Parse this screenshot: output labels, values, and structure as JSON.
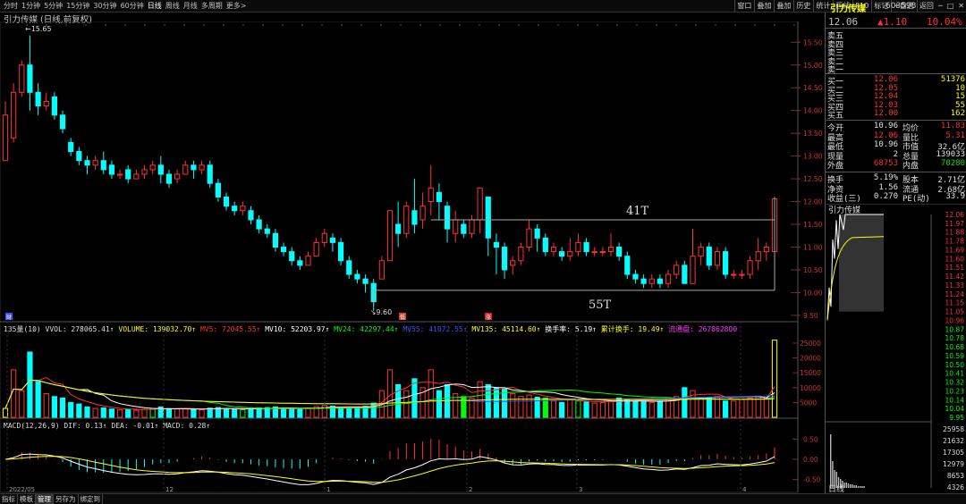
{
  "toolbar": {
    "periods": [
      "分时",
      "1分钟",
      "5分钟",
      "15分钟",
      "30分钟",
      "60分钟",
      "日线",
      "周线",
      "月线",
      "多周期",
      "更多>"
    ],
    "active_period": "日线",
    "tools": [
      "叠加",
      "叠加",
      "历史",
      "统计",
      "画线",
      "F10",
      "标记",
      "+自选",
      "返回"
    ],
    "tools_first": "窗口"
  },
  "chart": {
    "title": "引力传媒 (日线,前复权)",
    "high_label": "15.65",
    "low_label": "9.60",
    "annotation_41": "41T",
    "annotation_55": "55T",
    "marker_left": "财",
    "marker_mid1": "低",
    "marker_mid2": "涨",
    "y_ticks": [
      "15.50",
      "15.00",
      "14.50",
      "14.00",
      "13.50",
      "13.00",
      "12.50",
      "12.00",
      "11.50",
      "11.00",
      "10.50",
      "10.00",
      "9.50"
    ],
    "vol_ticks": [
      "25000",
      "20000",
      "15000",
      "10000",
      "5000"
    ],
    "macd_ticks": [
      "0.50",
      "0.00",
      "-0.50"
    ],
    "x_labels": [
      "2022/05",
      "12",
      "1",
      "2",
      "3",
      "4"
    ]
  },
  "chart_data": {
    "type": "candlestick",
    "ylim": [
      9.4,
      15.8
    ],
    "candles": [
      [
        12.9,
        13.9,
        13.3,
        14.1,
        14.2
      ],
      [
        13.4,
        14.4,
        13.3,
        14.6,
        14.6
      ],
      [
        14.4,
        15.0,
        14.3,
        15.1,
        15.1
      ],
      [
        15.0,
        14.4,
        14.0,
        15.65,
        15.65
      ],
      [
        14.4,
        14.1,
        13.9,
        14.6,
        14.6
      ],
      [
        14.1,
        14.2,
        14.0,
        14.4,
        14.4
      ],
      [
        14.3,
        13.9,
        13.8,
        14.4,
        14.4
      ],
      [
        13.9,
        13.6,
        13.5,
        14.0,
        14.0
      ],
      [
        13.3,
        13.1,
        13.0,
        13.4,
        13.4
      ],
      [
        13.1,
        12.9,
        12.8,
        13.2,
        13.2
      ],
      [
        12.9,
        12.8,
        12.6,
        13.0,
        13.0
      ],
      [
        12.8,
        12.9,
        12.7,
        13.0,
        13.0
      ],
      [
        12.9,
        12.7,
        12.6,
        13.1,
        13.1
      ],
      [
        12.8,
        12.6,
        12.5,
        12.9,
        12.9
      ],
      [
        12.6,
        12.6,
        12.5,
        12.7,
        12.7
      ],
      [
        12.7,
        12.5,
        12.4,
        12.8,
        12.8
      ],
      [
        12.5,
        12.6,
        12.5,
        12.7,
        12.7
      ],
      [
        12.6,
        12.7,
        12.5,
        12.8,
        12.8
      ],
      [
        12.7,
        12.8,
        12.6,
        12.9,
        12.9
      ],
      [
        12.8,
        12.6,
        12.4,
        13.0,
        13.0
      ],
      [
        12.6,
        12.4,
        12.3,
        12.7,
        12.7
      ],
      [
        12.5,
        12.6,
        12.4,
        12.7,
        12.7
      ],
      [
        12.6,
        12.8,
        12.6,
        12.9,
        12.9
      ],
      [
        12.8,
        12.7,
        12.5,
        12.9,
        12.9
      ],
      [
        12.7,
        12.8,
        12.6,
        12.9,
        12.9
      ],
      [
        12.8,
        12.4,
        12.3,
        12.9,
        12.9
      ],
      [
        12.4,
        12.1,
        12.0,
        12.5,
        12.5
      ],
      [
        12.1,
        11.9,
        11.8,
        12.2,
        12.2
      ],
      [
        11.9,
        11.8,
        11.7,
        12.0,
        12.0
      ],
      [
        11.8,
        11.9,
        11.7,
        12.0,
        12.0
      ],
      [
        11.8,
        11.6,
        11.5,
        11.9,
        11.9
      ],
      [
        11.6,
        11.4,
        11.3,
        11.7,
        11.7
      ],
      [
        11.4,
        11.3,
        11.2,
        11.5,
        11.5
      ],
      [
        11.3,
        11.0,
        10.9,
        11.4,
        11.4
      ],
      [
        11.0,
        10.9,
        10.8,
        11.1,
        11.1
      ],
      [
        10.9,
        10.7,
        10.6,
        11.0,
        11.0
      ],
      [
        10.7,
        10.6,
        10.5,
        10.8,
        10.8
      ],
      [
        10.6,
        10.8,
        10.6,
        10.9,
        10.9
      ],
      [
        10.8,
        11.1,
        10.8,
        11.2,
        11.2
      ],
      [
        11.1,
        11.3,
        11.0,
        11.4,
        11.4
      ],
      [
        11.2,
        11.1,
        10.9,
        11.3,
        11.3
      ],
      [
        11.1,
        10.7,
        10.6,
        11.2,
        11.2
      ],
      [
        10.7,
        10.4,
        10.3,
        10.8,
        10.8
      ],
      [
        10.4,
        10.3,
        10.2,
        10.5,
        10.5
      ],
      [
        10.3,
        10.2,
        10.0,
        10.4,
        10.4
      ],
      [
        10.2,
        9.8,
        9.6,
        10.3,
        10.3
      ],
      [
        10.3,
        10.7,
        10.3,
        10.8,
        10.8
      ],
      [
        10.7,
        11.8,
        10.7,
        11.8,
        11.8
      ],
      [
        11.5,
        11.3,
        11.0,
        12.0,
        12.0
      ],
      [
        11.3,
        11.9,
        11.2,
        12.0,
        12.0
      ],
      [
        11.8,
        11.5,
        11.3,
        12.5,
        12.5
      ],
      [
        11.6,
        11.9,
        11.4,
        12.2,
        12.2
      ],
      [
        12.0,
        12.3,
        11.7,
        12.4,
        12.8
      ],
      [
        12.2,
        12.0,
        11.6,
        12.4,
        12.4
      ],
      [
        11.9,
        11.4,
        11.1,
        12.0,
        12.0
      ],
      [
        11.3,
        11.6,
        11.1,
        11.8,
        11.8
      ],
      [
        11.5,
        11.3,
        11.2,
        11.6,
        11.6
      ],
      [
        11.3,
        11.6,
        11.2,
        11.7,
        11.7
      ],
      [
        11.6,
        12.3,
        11.3,
        12.3,
        12.3
      ],
      [
        12.1,
        11.2,
        10.8,
        12.1,
        12.1
      ],
      [
        11.1,
        11.0,
        10.4,
        11.3,
        11.3
      ],
      [
        11.0,
        10.5,
        10.3,
        11.1,
        11.1
      ],
      [
        10.6,
        10.7,
        10.4,
        10.8,
        10.8
      ],
      [
        10.7,
        11.0,
        10.6,
        11.1,
        11.1
      ],
      [
        11.0,
        11.4,
        10.9,
        11.6,
        11.6
      ],
      [
        11.4,
        11.2,
        10.9,
        11.5,
        11.5
      ],
      [
        11.2,
        10.9,
        10.8,
        11.3,
        11.3
      ],
      [
        10.9,
        11.0,
        10.8,
        11.1,
        11.1
      ],
      [
        10.9,
        10.8,
        10.7,
        11.0,
        11.0
      ],
      [
        10.8,
        10.9,
        10.7,
        11.2,
        11.2
      ],
      [
        10.9,
        11.1,
        10.8,
        11.3,
        11.3
      ],
      [
        11.1,
        10.9,
        10.8,
        11.2,
        11.2
      ],
      [
        10.9,
        10.9,
        10.8,
        11.0,
        11.0
      ],
      [
        10.9,
        10.9,
        10.8,
        11.0,
        11.0
      ],
      [
        10.9,
        11.0,
        10.8,
        11.3,
        11.3
      ],
      [
        11.0,
        10.8,
        10.7,
        11.1,
        11.1
      ],
      [
        10.8,
        10.4,
        10.3,
        10.9,
        10.9
      ],
      [
        10.4,
        10.3,
        10.2,
        10.5,
        10.5
      ],
      [
        10.3,
        10.2,
        10.1,
        10.4,
        10.4
      ],
      [
        10.2,
        10.3,
        10.1,
        10.4,
        10.4
      ],
      [
        10.3,
        10.2,
        10.1,
        10.4,
        10.4
      ],
      [
        10.2,
        10.4,
        10.1,
        10.5,
        10.5
      ],
      [
        10.4,
        10.6,
        10.3,
        10.7,
        10.7
      ],
      [
        10.6,
        10.2,
        10.2,
        10.7,
        10.7
      ],
      [
        10.2,
        10.8,
        10.2,
        11.4,
        11.4
      ],
      [
        10.8,
        11.0,
        10.6,
        11.1,
        11.1
      ],
      [
        11.0,
        10.6,
        10.5,
        11.1,
        11.1
      ],
      [
        10.6,
        10.9,
        10.5,
        11.0,
        11.0
      ],
      [
        10.9,
        10.4,
        10.3,
        11.0,
        11.0
      ],
      [
        10.4,
        10.4,
        10.3,
        10.5,
        10.5
      ],
      [
        10.4,
        10.4,
        10.3,
        10.5,
        10.5
      ],
      [
        10.4,
        10.7,
        10.3,
        10.8,
        10.8
      ],
      [
        10.7,
        10.9,
        10.5,
        11.2,
        11.2
      ],
      [
        10.9,
        11.0,
        10.7,
        11.1,
        11.1
      ],
      [
        10.9,
        12.06,
        10.9,
        12.06,
        12.06
      ]
    ]
  },
  "indicators": {
    "vol_label": "135量(10) VVOL: 278065.41↑",
    "volume": "VOLUME: 139032.70↑",
    "mv5": "MV5: 72045.55↑",
    "mv10": "MV10: 52203.97↑",
    "mv24": "MV24: 42297.44↑",
    "mv55": "MV55: 41072.55↑",
    "mv135": "MV135: 45114.60↑",
    "turnover": "换手率: 5.19↑",
    "cum_turnover": "累计换手: 19.49↑",
    "float_cap": "流通盘: 267862800",
    "macd_label": "MACD(12,26,9) DIF: 0.13↑ DEA: -0.01↑ MACD: 0.28↑"
  },
  "quote": {
    "name": "引力传媒",
    "code": "603598",
    "price": "12.06",
    "change": "▲1.10",
    "pct": "10.04%",
    "sells": [
      [
        "卖五",
        ""
      ],
      [
        "卖四",
        ""
      ],
      [
        "卖三",
        ""
      ],
      [
        "卖二",
        ""
      ],
      [
        "卖一",
        ""
      ]
    ],
    "buys": [
      [
        "买一",
        "12.06",
        "51376"
      ],
      [
        "买二",
        "12.05",
        "10"
      ],
      [
        "买三",
        "12.04",
        "15"
      ],
      [
        "买四",
        "12.03",
        "55"
      ],
      [
        "买五",
        "12.00",
        "162"
      ]
    ],
    "stats": [
      [
        "今开",
        "10.96",
        "均价",
        "11.83"
      ],
      [
        "最高",
        "12.06",
        "量比",
        "5.31"
      ],
      [
        "最低",
        "10.96",
        "市值",
        "32.6亿"
      ],
      [
        "现量",
        "2",
        "总量",
        "139033"
      ],
      [
        "外盘",
        "68753",
        "内盘",
        "70280"
      ]
    ],
    "stats2": [
      [
        "换手",
        "5.19%",
        "股本",
        "2.71亿"
      ],
      [
        "净资",
        "1.56",
        "流通",
        "2.68亿"
      ],
      [
        "收益(三)",
        "0.270",
        "PE(动)",
        "33.9"
      ]
    ]
  },
  "intraday": {
    "title": "引力传媒",
    "price_ticks": [
      "12.06",
      "11.97",
      "11.88",
      "11.78",
      "11.69",
      "11.60",
      "11.51",
      "11.42",
      "11.33",
      "11.24",
      "11.15",
      "11.05",
      "10.96",
      "10.87",
      "10.78",
      "10.68",
      "10.59",
      "10.50",
      "10.41",
      "10.32",
      "10.23",
      "10.14",
      "10.04",
      "9.95"
    ],
    "vol_ticks": [
      "25958",
      "21632",
      "17305",
      "12979",
      "8653",
      "4326"
    ],
    "tab": "日线"
  },
  "bottom_tabs": [
    "指标",
    "模板",
    "管理",
    "另存为",
    "绑定到"
  ]
}
